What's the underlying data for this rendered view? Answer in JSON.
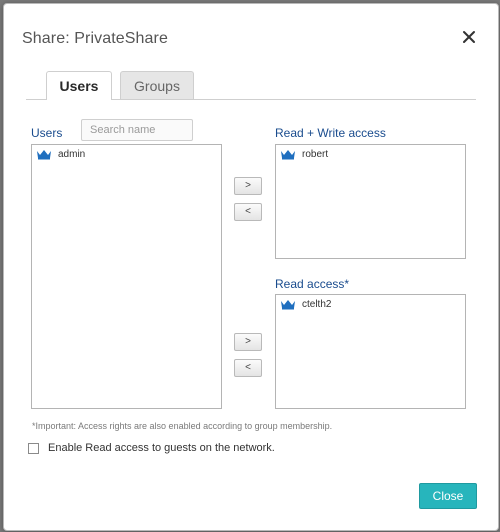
{
  "dialog": {
    "title": "Share: PrivateShare",
    "close_icon": "close-x-icon"
  },
  "tabs": [
    {
      "label": "Users",
      "active": true
    },
    {
      "label": "Groups",
      "active": false
    }
  ],
  "users_panel": {
    "label": "Users",
    "search_placeholder": "Search name",
    "items": [
      {
        "name": "admin",
        "icon": "user-crown-icon"
      }
    ]
  },
  "read_write_panel": {
    "label": "Read + Write access",
    "items": [
      {
        "name": "robert",
        "icon": "user-crown-icon"
      }
    ]
  },
  "read_panel": {
    "label": "Read access*",
    "items": [
      {
        "name": "ctelth2",
        "icon": "user-crown-icon"
      }
    ]
  },
  "buttons": {
    "add_rw": ">",
    "remove_rw": "<",
    "add_r": ">",
    "remove_r": "<",
    "close": "Close"
  },
  "note": "*Important: Access rights are also enabled according to group membership.",
  "guest_option": {
    "label": "Enable Read access to guests on the network.",
    "checked": false
  },
  "colors": {
    "accent": "#27b5bc",
    "label_blue": "#1a4c8e",
    "icon_blue": "#1f6fbf"
  }
}
